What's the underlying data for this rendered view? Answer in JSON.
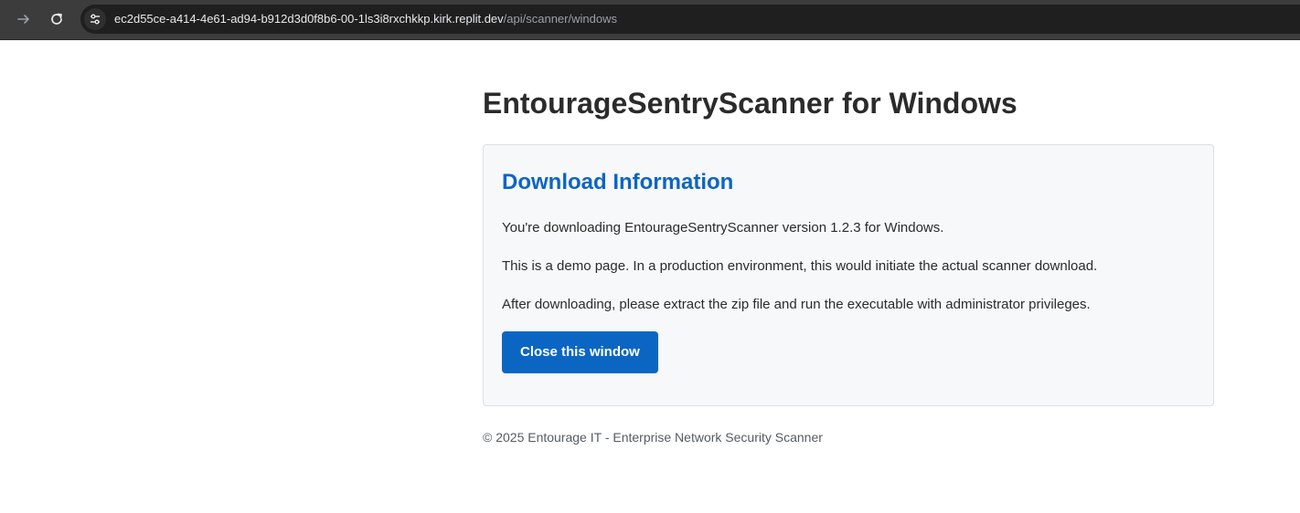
{
  "browser": {
    "url_host": "ec2d55ce-a414-4e61-ad94-b912d3d0f8b6-00-1ls3i8rxchkkp.kirk.replit.dev",
    "url_path": "/api/scanner/windows"
  },
  "page": {
    "title": "EntourageSentryScanner for Windows",
    "card": {
      "heading": "Download Information",
      "paragraphs": [
        "You're downloading EntourageSentryScanner version 1.2.3 for Windows.",
        "This is a demo page. In a production environment, this would initiate the actual scanner download.",
        "After downloading, please extract the zip file and run the executable with administrator privileges."
      ],
      "button_label": "Close this window"
    },
    "footer": "© 2025 Entourage IT - Enterprise Network Security Scanner"
  },
  "colors": {
    "toolbar_bg": "#3c3c3c",
    "accent_blue": "#0b66c3",
    "card_bg": "#f7f8fa",
    "text_dark": "#2b2b2b"
  },
  "icons": [
    "forward-arrow-icon",
    "reload-icon",
    "site-settings-icon"
  ]
}
